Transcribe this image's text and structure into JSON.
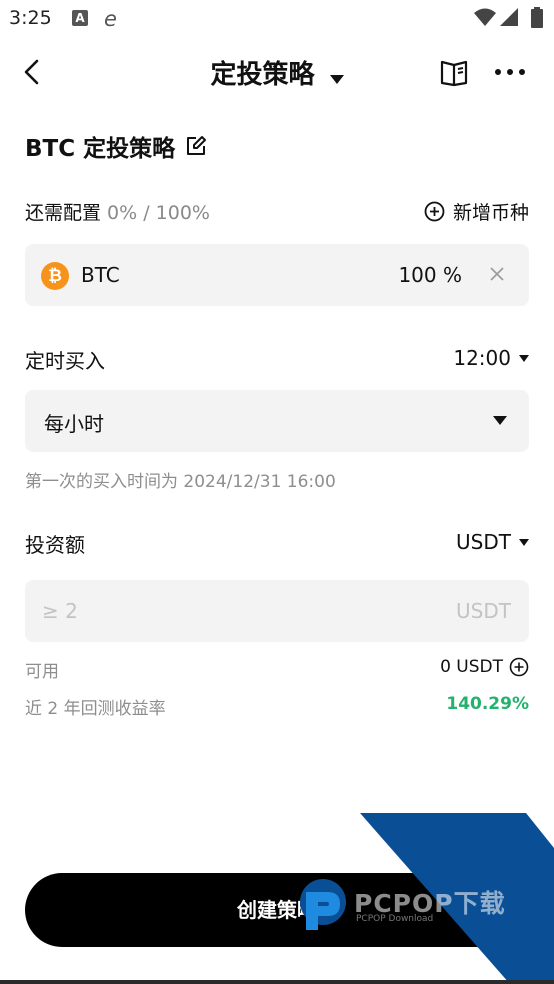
{
  "status_bar": {
    "time": "3:25",
    "notif_a": "A",
    "notif_e": "e"
  },
  "header": {
    "title": "定投策略"
  },
  "strategy": {
    "name": "BTC 定投策略"
  },
  "allocation": {
    "label": "还需配置",
    "progress": "0% / 100%",
    "add_coin_label": "新增币种"
  },
  "coins": [
    {
      "icon": "₿",
      "name": "BTC",
      "percent": "100 %",
      "icon_color": "#f7931a"
    }
  ],
  "schedule": {
    "label": "定时买入",
    "time": "12:00",
    "frequency": "每小时",
    "hint": "第一次的买入时间为 2024/12/31 16:00"
  },
  "investment": {
    "label": "投资额",
    "currency": "USDT",
    "placeholder": "≥ 2",
    "unit": "USDT",
    "available_label": "可用",
    "available_value": "0 USDT",
    "backtest_label": "近 2 年回测收益率",
    "backtest_value": "140.29%"
  },
  "actions": {
    "create_label": "创建策略"
  },
  "watermark": {
    "brand": "PCPOP下载",
    "sub": "PCPOP Download"
  },
  "colors": {
    "accent_green": "#23b26d",
    "btc_orange": "#f7931a",
    "watermark_blue": "#0a4f96"
  }
}
